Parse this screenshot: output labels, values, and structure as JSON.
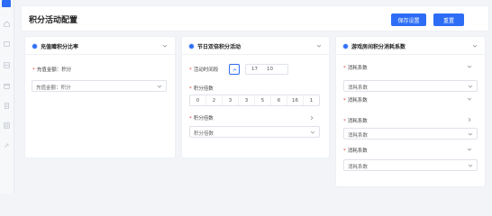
{
  "header": {
    "title": "积分活动配置",
    "save_label": "保存设置",
    "reset_label": "重置"
  },
  "colors": {
    "accent": "#2d6df6",
    "required": "#e54545",
    "background": "#f2f4f8"
  },
  "sidebar": {
    "icons": [
      "app-logo-icon",
      "home-icon",
      "folder-icon",
      "grid-icon",
      "calendar-icon",
      "document-icon",
      "settings-icon",
      "tools-icon"
    ]
  },
  "panel1": {
    "title": "充值赠积分比率",
    "field_label": "充值金额：积分",
    "select_value": "充值金额：积分"
  },
  "panel2": {
    "title": "节日双倍积分活动",
    "time_label": "活动时间段",
    "time_start": "17",
    "time_end": "10",
    "multiplier_label": "积分倍数",
    "multiplier_values": [
      "0",
      "2",
      "3",
      "3",
      "5",
      "6",
      "16",
      "1"
    ],
    "multiplier_label_2": "积分倍数",
    "multiplier_select": "积分倍数"
  },
  "panel3": {
    "title": "游戏房间积分消耗系数",
    "fields": [
      {
        "label": "消耗系数",
        "value": "消耗系数"
      },
      {
        "label": "消耗系数",
        "value": "消耗系数"
      },
      {
        "label": "消耗系数",
        "value": "消耗系数"
      },
      {
        "label": "消耗系数",
        "value": "消耗系数"
      }
    ]
  }
}
